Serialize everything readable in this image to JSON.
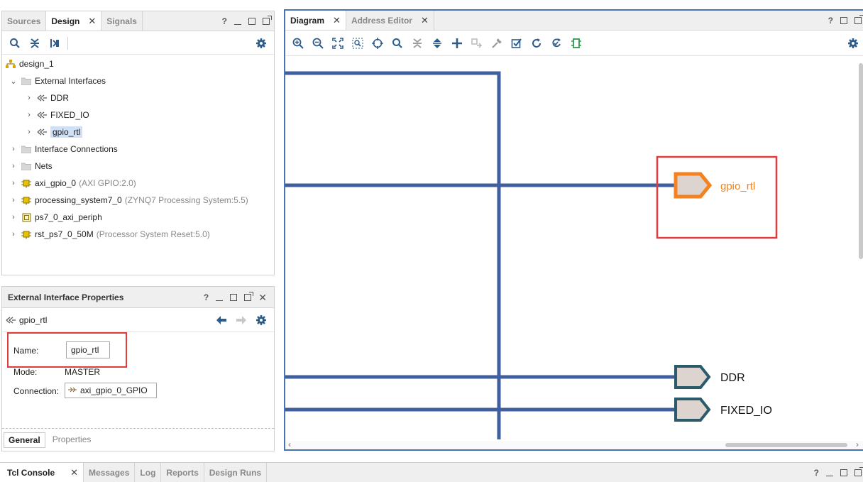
{
  "sources_panel": {
    "tabs": [
      {
        "label": "Sources",
        "active": false
      },
      {
        "label": "Design",
        "active": true
      },
      {
        "label": "Signals",
        "active": false
      }
    ],
    "tree": [
      {
        "label": "design_1",
        "meta": "",
        "icon": "hierarchy-icon",
        "chevron": ""
      },
      {
        "label": "External Interfaces",
        "meta": "",
        "icon": "folder-icon",
        "chevron": "expanded"
      },
      {
        "label": "DDR",
        "meta": "",
        "icon": "interface-port-icon",
        "chevron": "collapsed"
      },
      {
        "label": "FIXED_IO",
        "meta": "",
        "icon": "interface-port-icon",
        "chevron": "collapsed"
      },
      {
        "label": "gpio_rtl",
        "meta": "",
        "icon": "interface-port-icon",
        "chevron": "collapsed",
        "selected": true
      },
      {
        "label": "Interface Connections",
        "meta": "",
        "icon": "folder-icon",
        "chevron": "collapsed"
      },
      {
        "label": "Nets",
        "meta": "",
        "icon": "folder-icon",
        "chevron": "collapsed"
      },
      {
        "label": "axi_gpio_0",
        "meta": "(AXI GPIO:2.0)",
        "icon": "ip-block-icon",
        "chevron": "collapsed"
      },
      {
        "label": "processing_system7_0",
        "meta": "(ZYNQ7 Processing System:5.5)",
        "icon": "ip-block-icon",
        "chevron": "collapsed"
      },
      {
        "label": "ps7_0_axi_periph",
        "meta": "",
        "icon": "hier-block-icon",
        "chevron": "collapsed"
      },
      {
        "label": "rst_ps7_0_50M",
        "meta": "(Processor System Reset:5.0)",
        "icon": "ip-block-icon",
        "chevron": "collapsed"
      }
    ]
  },
  "properties_panel": {
    "title": "External Interface Properties",
    "object_name": "gpio_rtl",
    "name_label": "Name:",
    "name_value": "gpio_rtl",
    "mode_label": "Mode:",
    "mode_value": "MASTER",
    "connection_label": "Connection:",
    "connection_value": "axi_gpio_0_GPIO",
    "bottom_tabs": [
      {
        "label": "General",
        "active": true
      },
      {
        "label": "Properties",
        "active": false
      }
    ]
  },
  "diagram_panel": {
    "tabs": [
      {
        "label": "Diagram",
        "active": true
      },
      {
        "label": "Address Editor",
        "active": false
      }
    ],
    "ports": {
      "gpio": "gpio_rtl",
      "ddr": "DDR",
      "fixed_io": "FIXED_IO"
    },
    "colors": {
      "wire": "#3f5f9e",
      "selected_port": "#f58220",
      "port_outline": "#2b5a6b",
      "port_fill": "#ddd3cf",
      "highlight": "#e23b3b"
    }
  },
  "console_panel": {
    "tabs": [
      {
        "label": "Tcl Console",
        "active": true
      },
      {
        "label": "Messages",
        "active": false
      },
      {
        "label": "Log",
        "active": false
      },
      {
        "label": "Reports",
        "active": false
      },
      {
        "label": "Design Runs",
        "active": false
      }
    ]
  },
  "window_controls": {
    "help": "?"
  }
}
